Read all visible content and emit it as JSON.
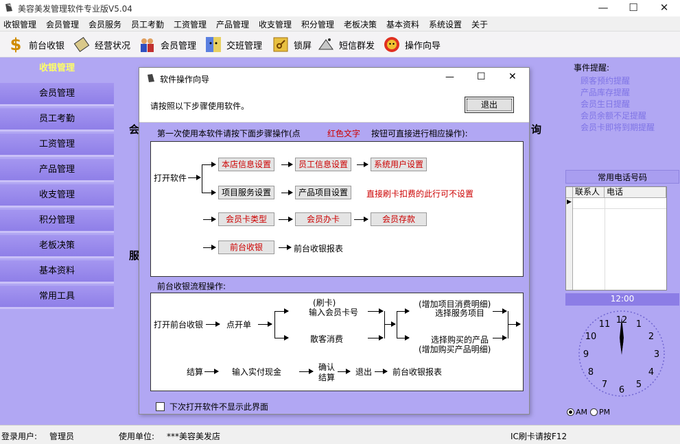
{
  "window": {
    "title": "美容美发管理软件专业版V5.04",
    "min": "—",
    "max": "☐",
    "close": "✕"
  },
  "menu": [
    "收银管理",
    "会员管理",
    "会员服务",
    "员工考勤",
    "工资管理",
    "产品管理",
    "收支管理",
    "积分管理",
    "老板决策",
    "基本资料",
    "系统设置",
    "关于"
  ],
  "toolbar": [
    {
      "label": "前台收银",
      "icon": "dollar-icon"
    },
    {
      "label": "经营状况",
      "icon": "notebook-icon"
    },
    {
      "label": "会员管理",
      "icon": "members-icon"
    },
    {
      "label": "交班管理",
      "icon": "finder-face-icon"
    },
    {
      "label": "锁屏",
      "icon": "key-icon"
    },
    {
      "label": "短信群发",
      "icon": "satellite-icon"
    },
    {
      "label": "操作向导",
      "icon": "gear-face-icon"
    }
  ],
  "sidebar": [
    "收银管理",
    "会员管理",
    "员工考勤",
    "工资管理",
    "产品管理",
    "收支管理",
    "积分管理",
    "老板决策",
    "基本资料",
    "常用工具"
  ],
  "background": {
    "left_a": "会",
    "left_b": "服",
    "right": "询"
  },
  "right_panel": {
    "event_title": "事件提醒:",
    "events": [
      "顾客预约提醒",
      "产品库存提醒",
      "会员生日提醒",
      "会员余额不足提醒",
      "会员卡即将到期提醒"
    ],
    "phone_title": "常用电话号码",
    "phone_cols": [
      "联系人",
      "电话"
    ],
    "clock_time": "12:00",
    "am": "AM",
    "pm": "PM"
  },
  "dialog": {
    "title": "软件操作向导",
    "min": "—",
    "max": "☐",
    "close": "✕",
    "instruction": "请按照以下步骤使用软件。",
    "exit": "退出",
    "first_use_prefix": "第一次使用本软件请按下面步骤操作(点",
    "red_text": "红色文字",
    "first_use_suffix": "按钮可直接进行相应操作):",
    "open_software": "打开软件",
    "row1": [
      "本店信息设置",
      "员工信息设置",
      "系统用户设置"
    ],
    "row2": [
      "项目服务设置",
      "产品项目设置"
    ],
    "row2_note": "直接刷卡扣费的此行可不设置",
    "row3": [
      "会员卡类型",
      "会员办卡",
      "会员存款"
    ],
    "row4_btn": "前台收银",
    "row4_text": "前台收银报表",
    "flow_title": "前台收银流程操作:",
    "flow": {
      "open": "打开前台收银",
      "order": "点开单",
      "swipe": "(刷卡)",
      "input_card": "输入会员卡号",
      "walkin": "散客消费",
      "add_item": "(增加项目消费明细)",
      "select_service": "选择服务项目",
      "select_product": "选择购买的产品",
      "add_product": "(增加购买产品明细)",
      "checkout": "结算",
      "cash": "输入实付现金",
      "confirm1": "确认",
      "confirm2": "结算",
      "quit": "退出",
      "report": "前台收银报表"
    },
    "checkbox_label": "下次打开软件不显示此界面"
  },
  "status": {
    "login_label": "登录用户:",
    "login_user": "管理员",
    "unit_label": "使用单位:",
    "unit": "***美容美发店",
    "hint": "IC刷卡请按F12"
  },
  "colors": {
    "main_bg": "#b1a7f3",
    "red_text": "#cc0000",
    "link": "#7f74e6"
  }
}
